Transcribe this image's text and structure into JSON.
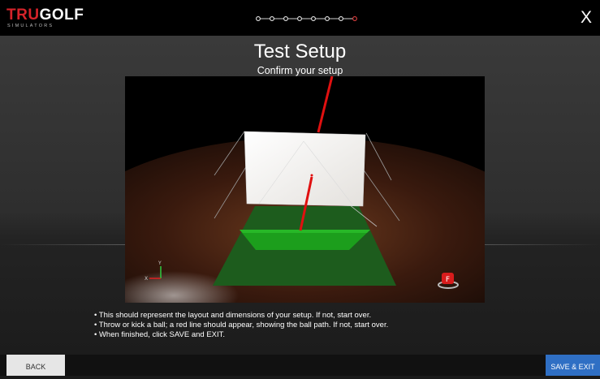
{
  "header": {
    "logo_tru": "TRU",
    "logo_golf": "GOLF",
    "logo_sub": "SIMULATORS",
    "close_label": "X",
    "progress": {
      "total_steps": 8,
      "current_step": 8
    }
  },
  "main": {
    "title": "Test Setup",
    "subtitle": "Confirm your setup",
    "scene": {
      "flag_label": "F",
      "axis_y": "Y",
      "axis_x": "X",
      "colors": {
        "screen": "#f2f0ee",
        "turf": "#1d5c1d",
        "hitting_mat": "#1c9e1c",
        "ball_path": "#e01010",
        "floor": "#3a1a0e"
      }
    },
    "instructions": [
      "• This should represent the layout and dimensions of your setup. If not, start over.",
      "• Throw or kick a ball; a red line should appear, showing the ball path. If not, start over.",
      "• When finished, click SAVE and EXIT."
    ]
  },
  "footer": {
    "back_label": "BACK",
    "save_label": "SAVE & EXIT"
  },
  "colors": {
    "accent": "#2f6fc4",
    "brand_red": "#d6232a",
    "progress_active": "#e04040"
  }
}
